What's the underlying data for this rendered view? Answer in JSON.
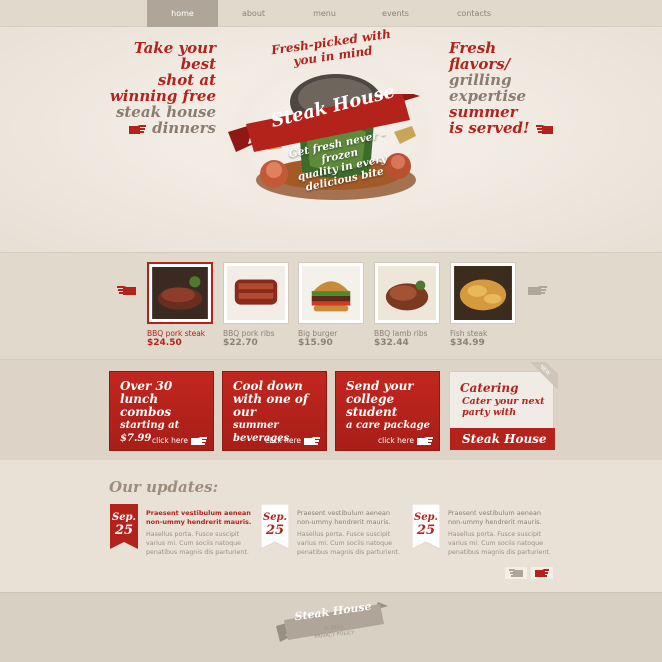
{
  "nav": {
    "items": [
      {
        "label": "home"
      },
      {
        "label": "about"
      },
      {
        "label": "menu"
      },
      {
        "label": "events"
      },
      {
        "label": "contacts"
      }
    ]
  },
  "hero": {
    "left": {
      "l1": "Take your best",
      "l2": "shot at",
      "l3": "winning free",
      "l4": "steak house",
      "l5": "dinners"
    },
    "right": {
      "l1": "Fresh flavors/",
      "l2": "grilling expertise",
      "l3": "summer",
      "l4": "is served!"
    },
    "tagline_top_1": "Fresh-picked with",
    "tagline_top_2": "you in mind",
    "ribbon": "Steak House",
    "sub_1": "Get fresh never - frozen",
    "sub_2": "quality in every",
    "sub_3": "delicious bite"
  },
  "products": [
    {
      "name": "BBQ pork steak",
      "price": "$24.50",
      "selected": true
    },
    {
      "name": "BBQ pork ribs",
      "price": "$22.70",
      "selected": false
    },
    {
      "name": "Big burger",
      "price": "$15.90",
      "selected": false
    },
    {
      "name": "BBQ lamb ribs",
      "price": "$32.44",
      "selected": false
    },
    {
      "name": "Fish steak",
      "price": "$34.99",
      "selected": false
    }
  ],
  "promos": [
    {
      "l1": "Over 30",
      "l2": "lunch combos",
      "l3": "starting at $7.99",
      "cta": "click here"
    },
    {
      "l1": "Cool down",
      "l2": "with one of our",
      "l3": "summer beverages",
      "cta": "click here"
    },
    {
      "l1": "Send your",
      "l2": "college student",
      "l3": "a care package",
      "cta": "click here"
    }
  ],
  "catering": {
    "title": "Catering",
    "sub_1": "Cater your next",
    "sub_2": "party with",
    "bar": "Steak House",
    "badge": "NEW"
  },
  "updates": {
    "title": "Our updates:",
    "posts": [
      {
        "month": "Sep.",
        "day": "25",
        "title": "Praesent vestibulum aenean non-ummy hendrerit mauris.",
        "body": "Hasellus porta. Fusce suscipit varius mi. Cum sociis natoque penatibus magnis dis parturient."
      },
      {
        "month": "Sep.",
        "day": "25",
        "title": "Praesent vestibulum aenean non-ummy hendrerit mauris.",
        "body": "Hasellus porta. Fusce suscipit varius mi. Cum sociis natoque penatibus magnis dis parturient."
      },
      {
        "month": "Sep.",
        "day": "25",
        "title": "Praesent vestibulum aenean non-ummy hendrerit mauris.",
        "body": "Hasellus porta. Fusce suscipit varius mi. Cum sociis natoque penatibus magnis dis parturient."
      }
    ]
  },
  "footer": {
    "logo": "Steak House",
    "copyright": "© 2013",
    "privacy": "PRIVACY POLICY"
  },
  "colors": {
    "accent": "#b4221c",
    "background": "#e9e1d6",
    "muted": "#8c8176"
  }
}
